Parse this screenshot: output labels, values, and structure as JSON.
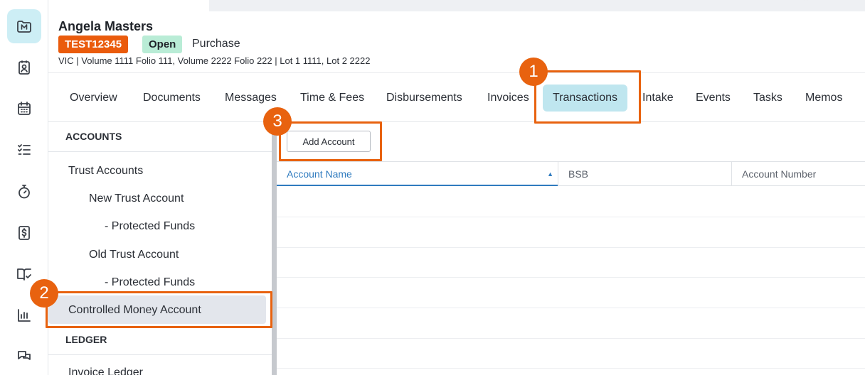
{
  "rail": {
    "icons": [
      "matter-icon",
      "contact-card-icon",
      "calendar-icon",
      "checklist-icon",
      "stopwatch-icon",
      "dollar-document-icon",
      "book-check-icon",
      "bar-chart-icon",
      "chat-bubbles-icon"
    ],
    "matter_letter": "M"
  },
  "header": {
    "client_name": "Angela Masters",
    "reference": "TEST12345",
    "status": "Open",
    "matter_type": "Purchase",
    "property": "VIC | Volume 1111 Folio 111, Volume 2222 Folio 222 | Lot 1 1111, Lot 2 2222"
  },
  "tabs": [
    {
      "label": "Overview"
    },
    {
      "label": "Documents"
    },
    {
      "label": "Messages"
    },
    {
      "label": "Time & Fees"
    },
    {
      "label": "Disbursements"
    },
    {
      "label": "Invoices"
    },
    {
      "label": "Transactions"
    },
    {
      "label": "Intake"
    },
    {
      "label": "Events"
    },
    {
      "label": "Tasks"
    },
    {
      "label": "Memos"
    }
  ],
  "sidebar": {
    "accounts_title": "ACCOUNTS",
    "items": [
      {
        "label": "Trust Accounts"
      },
      {
        "label": "New Trust Account"
      },
      {
        "label": "- Protected Funds"
      },
      {
        "label": "Old Trust Account"
      },
      {
        "label": "- Protected Funds"
      },
      {
        "label": "Controlled Money Account"
      }
    ],
    "ledger_title": "LEDGER",
    "ledger_items": [
      {
        "label": "Invoice Ledger"
      }
    ]
  },
  "main": {
    "add_button": "Add Account",
    "columns": [
      {
        "label": "Account Name"
      },
      {
        "label": "BSB"
      },
      {
        "label": "Account Number"
      }
    ]
  },
  "callouts": [
    "1",
    "2",
    "3"
  ],
  "colors": {
    "accent_orange": "#e8620f",
    "active_tab": "#bfe6ef",
    "status_green": "#b9ecd6",
    "sort_blue": "#2f7bbf"
  }
}
